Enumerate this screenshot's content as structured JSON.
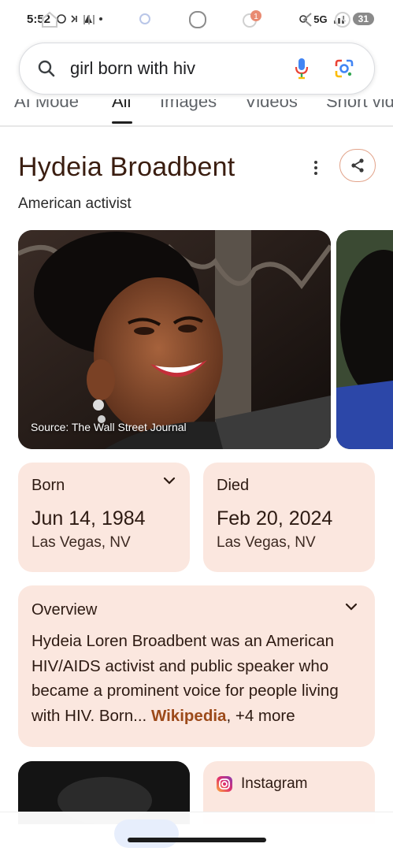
{
  "status_bar": {
    "time": "5:52",
    "network": "5G",
    "battery": "31"
  },
  "search": {
    "query": "girl born with hiv"
  },
  "tabs": [
    {
      "label": "AI Mode"
    },
    {
      "label": "All"
    },
    {
      "label": "Images"
    },
    {
      "label": "Videos"
    },
    {
      "label": "Short vid"
    }
  ],
  "entity": {
    "title": "Hydeia Broadbent",
    "subtitle": "American activist",
    "photo_source": "Source: The Wall Street Journal"
  },
  "born": {
    "label": "Born",
    "date": "Jun 14, 1984",
    "place": "Las Vegas, NV"
  },
  "died": {
    "label": "Died",
    "date": "Feb 20, 2024",
    "place": "Las Vegas, NV"
  },
  "overview": {
    "label": "Overview",
    "text": "Hydeia Loren Broadbent was an American HIV/AIDS activist and public speaker who became a prominent voice for people living with HIV. Born",
    "ellipsis": "...",
    "source_link": "Wikipedia",
    "more": ", +4 more"
  },
  "instagram": {
    "label": "Instagram"
  },
  "nav": {
    "badge": "1"
  },
  "colors": {
    "card_bg": "#fbe7df",
    "title_color": "#3a1d10",
    "link_color": "#9c4a1a",
    "share_border": "#e2a38a"
  }
}
